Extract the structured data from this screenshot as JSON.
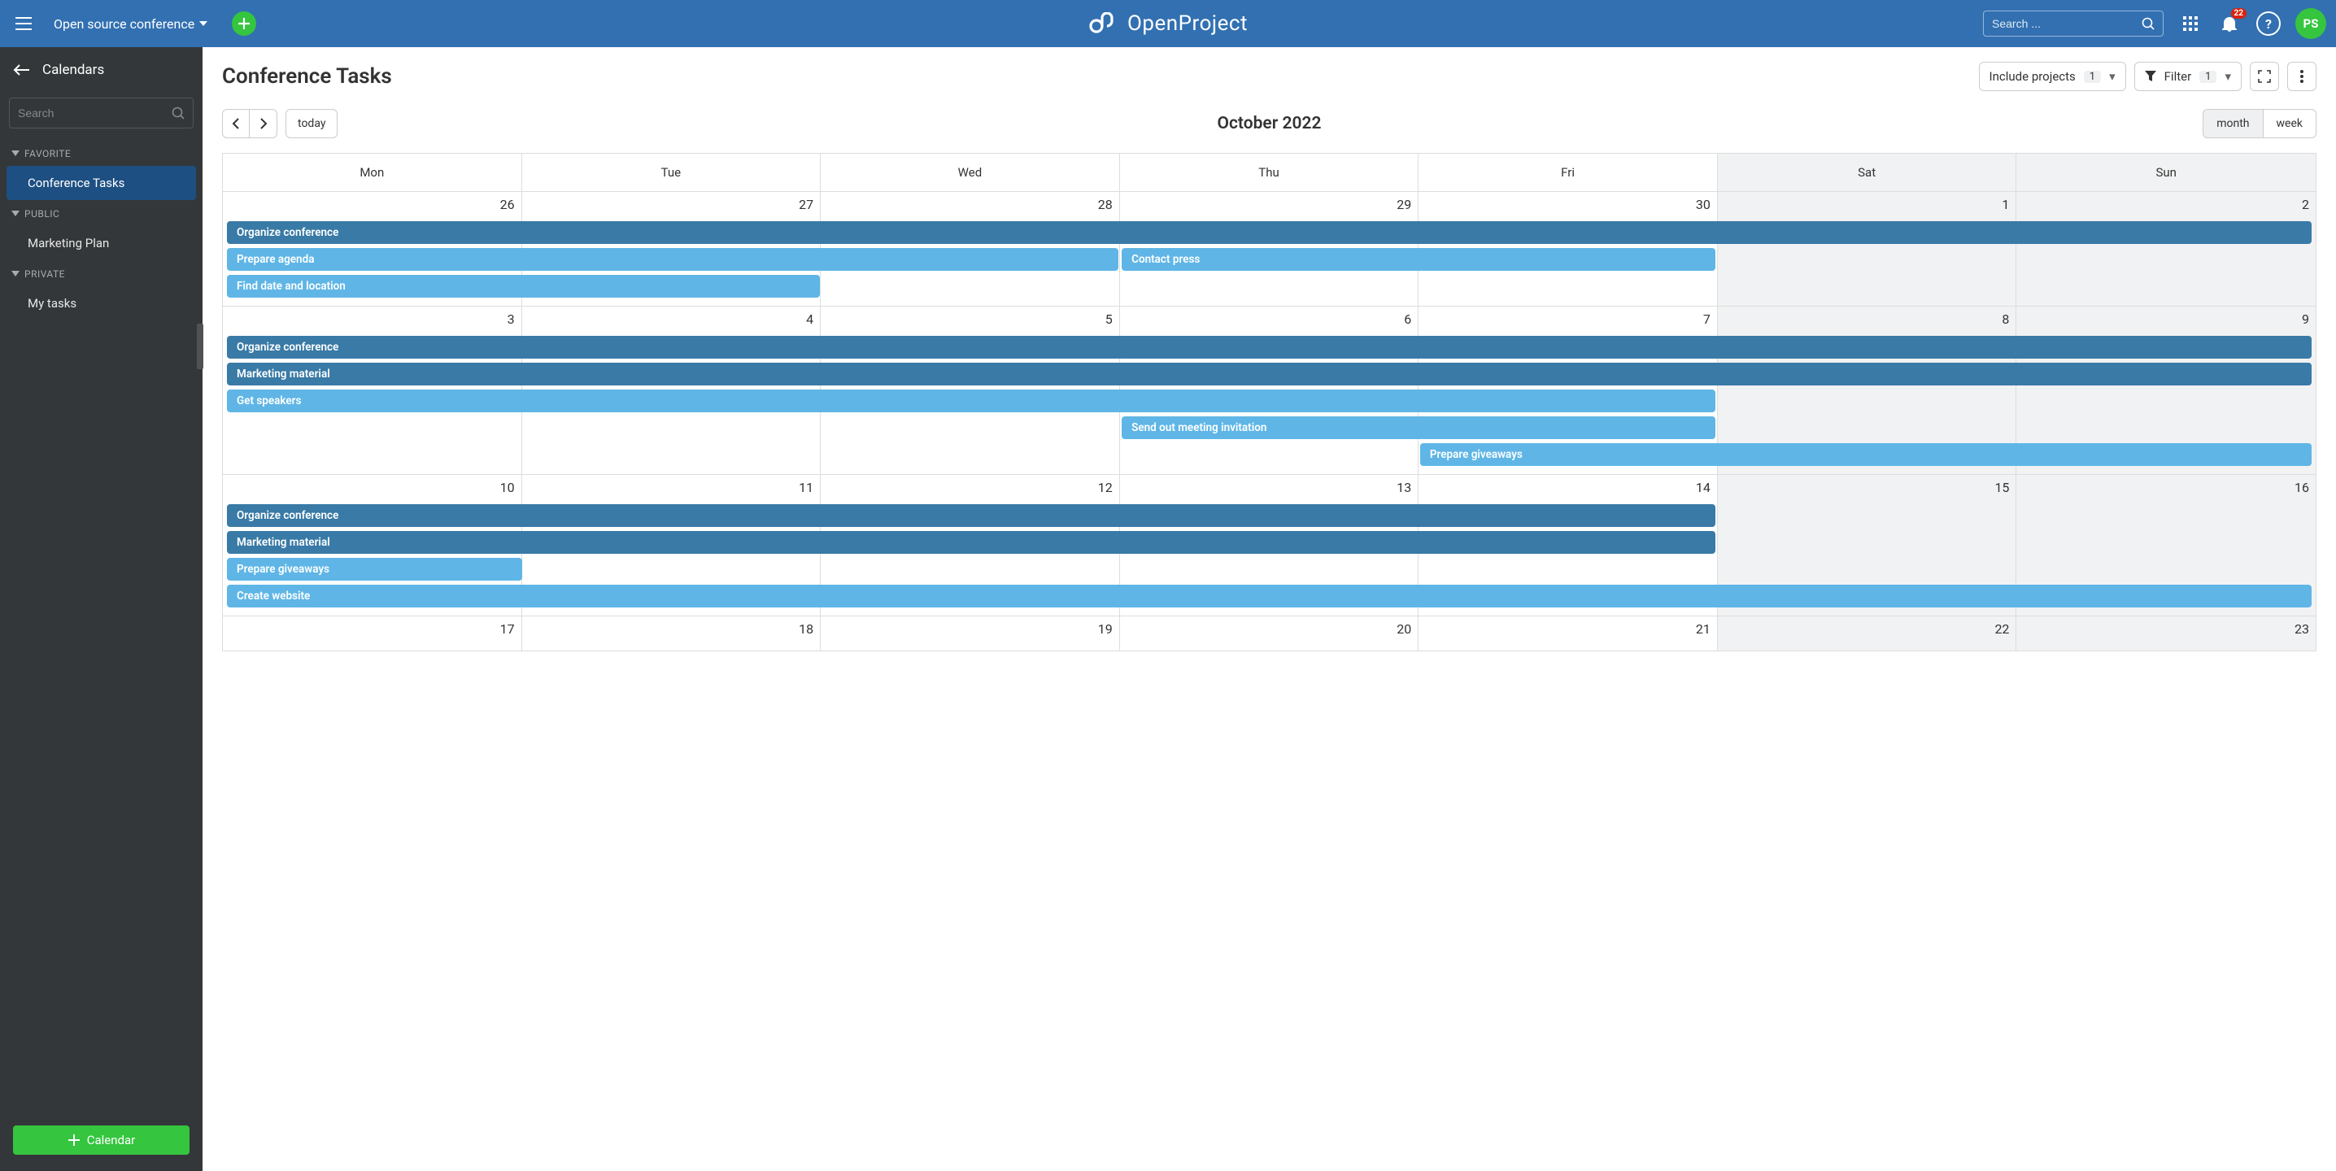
{
  "header": {
    "project": "Open source conference",
    "search_placeholder": "Search ...",
    "notification_count": "22",
    "avatar_initials": "PS",
    "brand": "OpenProject"
  },
  "sidebar": {
    "title": "Calendars",
    "search_placeholder": "Search",
    "sections": [
      {
        "label": "FAVORITE",
        "items": [
          {
            "label": "Conference Tasks",
            "active": true
          }
        ]
      },
      {
        "label": "PUBLIC",
        "items": [
          {
            "label": "Marketing Plan",
            "active": false
          }
        ]
      },
      {
        "label": "PRIVATE",
        "items": [
          {
            "label": "My tasks",
            "active": false
          }
        ]
      }
    ],
    "add_label": "Calendar"
  },
  "page": {
    "title": "Conference Tasks",
    "include_projects_label": "Include projects",
    "include_projects_count": "1",
    "filter_label": "Filter",
    "filter_count": "1",
    "today_label": "today",
    "month_title": "October 2022",
    "view_month": "month",
    "view_week": "week",
    "day_headers": [
      "Mon",
      "Tue",
      "Wed",
      "Thu",
      "Fri",
      "Sat",
      "Sun"
    ]
  },
  "calendar": {
    "weeks": [
      {
        "dates": [
          "26",
          "27",
          "28",
          "29",
          "30",
          "1",
          "2"
        ],
        "other_month": [
          true,
          true,
          true,
          true,
          true,
          false,
          false
        ],
        "events": [
          {
            "label": "Organize conference",
            "tone": "dark",
            "start": 0,
            "span": 7
          },
          {
            "label": "Prepare agenda",
            "tone": "light",
            "start": 0,
            "span": 3
          },
          {
            "label": "Contact press",
            "tone": "light",
            "start": 3,
            "span": 2,
            "same_row_as_prev": true
          },
          {
            "label": "Find date and location",
            "tone": "light",
            "start": 0,
            "span": 2
          }
        ]
      },
      {
        "dates": [
          "3",
          "4",
          "5",
          "6",
          "7",
          "8",
          "9"
        ],
        "other_month": [
          false,
          false,
          false,
          false,
          false,
          false,
          false
        ],
        "events": [
          {
            "label": "Organize conference",
            "tone": "dark",
            "start": 0,
            "span": 7
          },
          {
            "label": "Marketing material",
            "tone": "dark",
            "start": 0,
            "span": 7
          },
          {
            "label": "Get speakers",
            "tone": "light",
            "start": 0,
            "span": 5
          },
          {
            "label": "Send out meeting invitation",
            "tone": "light",
            "start": 3,
            "span": 2
          },
          {
            "label": "Prepare giveaways",
            "tone": "light",
            "start": 4,
            "span": 3
          }
        ]
      },
      {
        "dates": [
          "10",
          "11",
          "12",
          "13",
          "14",
          "15",
          "16"
        ],
        "other_month": [
          false,
          false,
          false,
          false,
          false,
          false,
          false
        ],
        "events": [
          {
            "label": "Organize conference",
            "tone": "dark",
            "start": 0,
            "span": 5
          },
          {
            "label": "Marketing material",
            "tone": "dark",
            "start": 0,
            "span": 5
          },
          {
            "label": "Prepare giveaways",
            "tone": "light",
            "start": 0,
            "span": 1
          },
          {
            "label": "Create website",
            "tone": "light",
            "start": 0,
            "span": 7
          }
        ]
      },
      {
        "dates": [
          "17",
          "18",
          "19",
          "20",
          "21",
          "22",
          "23"
        ],
        "other_month": [
          false,
          false,
          false,
          false,
          false,
          false,
          false
        ],
        "events": []
      }
    ]
  }
}
